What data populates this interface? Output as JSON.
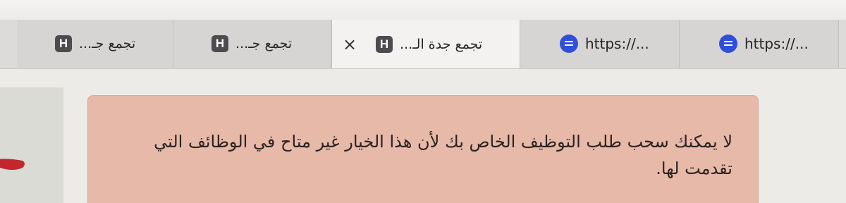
{
  "browser": {
    "tabs": [
      {
        "title": "تجمع جـ...",
        "favicon": "h-letter-icon",
        "favicon_letter": "H",
        "active": false
      },
      {
        "title": "تجمع جـ...",
        "favicon": "h-letter-icon",
        "favicon_letter": "H",
        "active": false
      },
      {
        "title": "تجمع جدة الـ...",
        "favicon": "h-letter-icon",
        "favicon_letter": "H",
        "active": true,
        "close": "×"
      },
      {
        "title": "https://...",
        "favicon": "document-icon",
        "active": false
      },
      {
        "title": "https://...",
        "favicon": "document-icon",
        "active": false
      }
    ]
  },
  "alert": {
    "message": "لا يمكنك سحب طلب التوظيف الخاص بك لأن هذا الخيار غير متاح في الوظائف التي تقدمت لها."
  },
  "colors": {
    "alert_background": "#e7b9a8",
    "favicon_h": "#4c4b4f",
    "favicon_doc": "#2f4fd8",
    "accent_mark": "#c4262e"
  }
}
